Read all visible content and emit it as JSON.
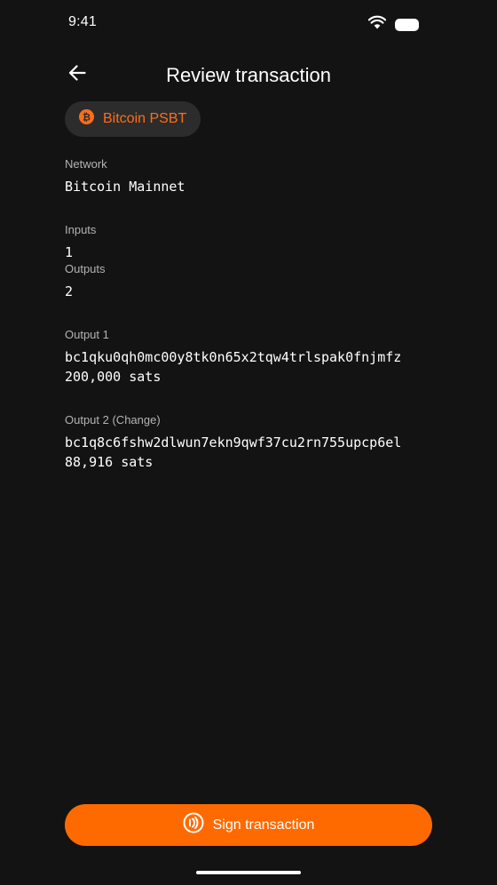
{
  "status_bar": {
    "time": "9:41"
  },
  "header": {
    "title": "Review transaction"
  },
  "chip": {
    "label": "Bitcoin PSBT",
    "icon": "bitcoin-icon"
  },
  "fields": {
    "network": {
      "label": "Network",
      "value": "Bitcoin Mainnet"
    },
    "inputs": {
      "label": "Inputs",
      "value": "1"
    },
    "outputs": {
      "label": "Outputs",
      "value": "2"
    },
    "output1": {
      "label": "Output 1",
      "address": "bc1qku0qh0mc00y8tk0n65x2tqw4trlspak0fnjmfz",
      "amount": "200,000 sats"
    },
    "output2": {
      "label": "Output 2 (Change)",
      "address": "bc1q8c6fshw2dlwun7ekn9qwf37cu2rn755upcp6el",
      "amount": "88,916 sats"
    }
  },
  "sign_button": {
    "label": "Sign transaction",
    "icon": "nfc-sign-icon"
  },
  "colors": {
    "background": "#131313",
    "accent": "#ff6a00",
    "chip_bg": "#2c2c2c",
    "label": "#b3b3b3"
  }
}
